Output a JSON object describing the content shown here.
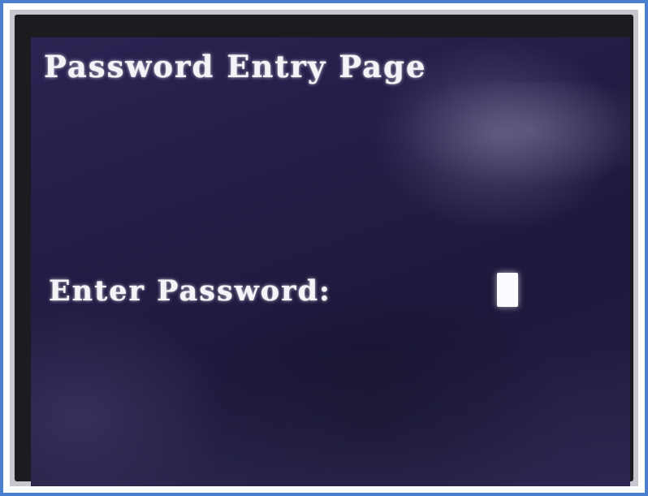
{
  "screen": {
    "title": "Password Entry Page",
    "prompt_label": "Enter Password:",
    "password_field": {
      "value": "",
      "cursor": "block-cursor"
    }
  },
  "colors": {
    "photo_border": "#4a7fcf",
    "screen_background": "#221d46",
    "text": "#f4f4f8"
  }
}
